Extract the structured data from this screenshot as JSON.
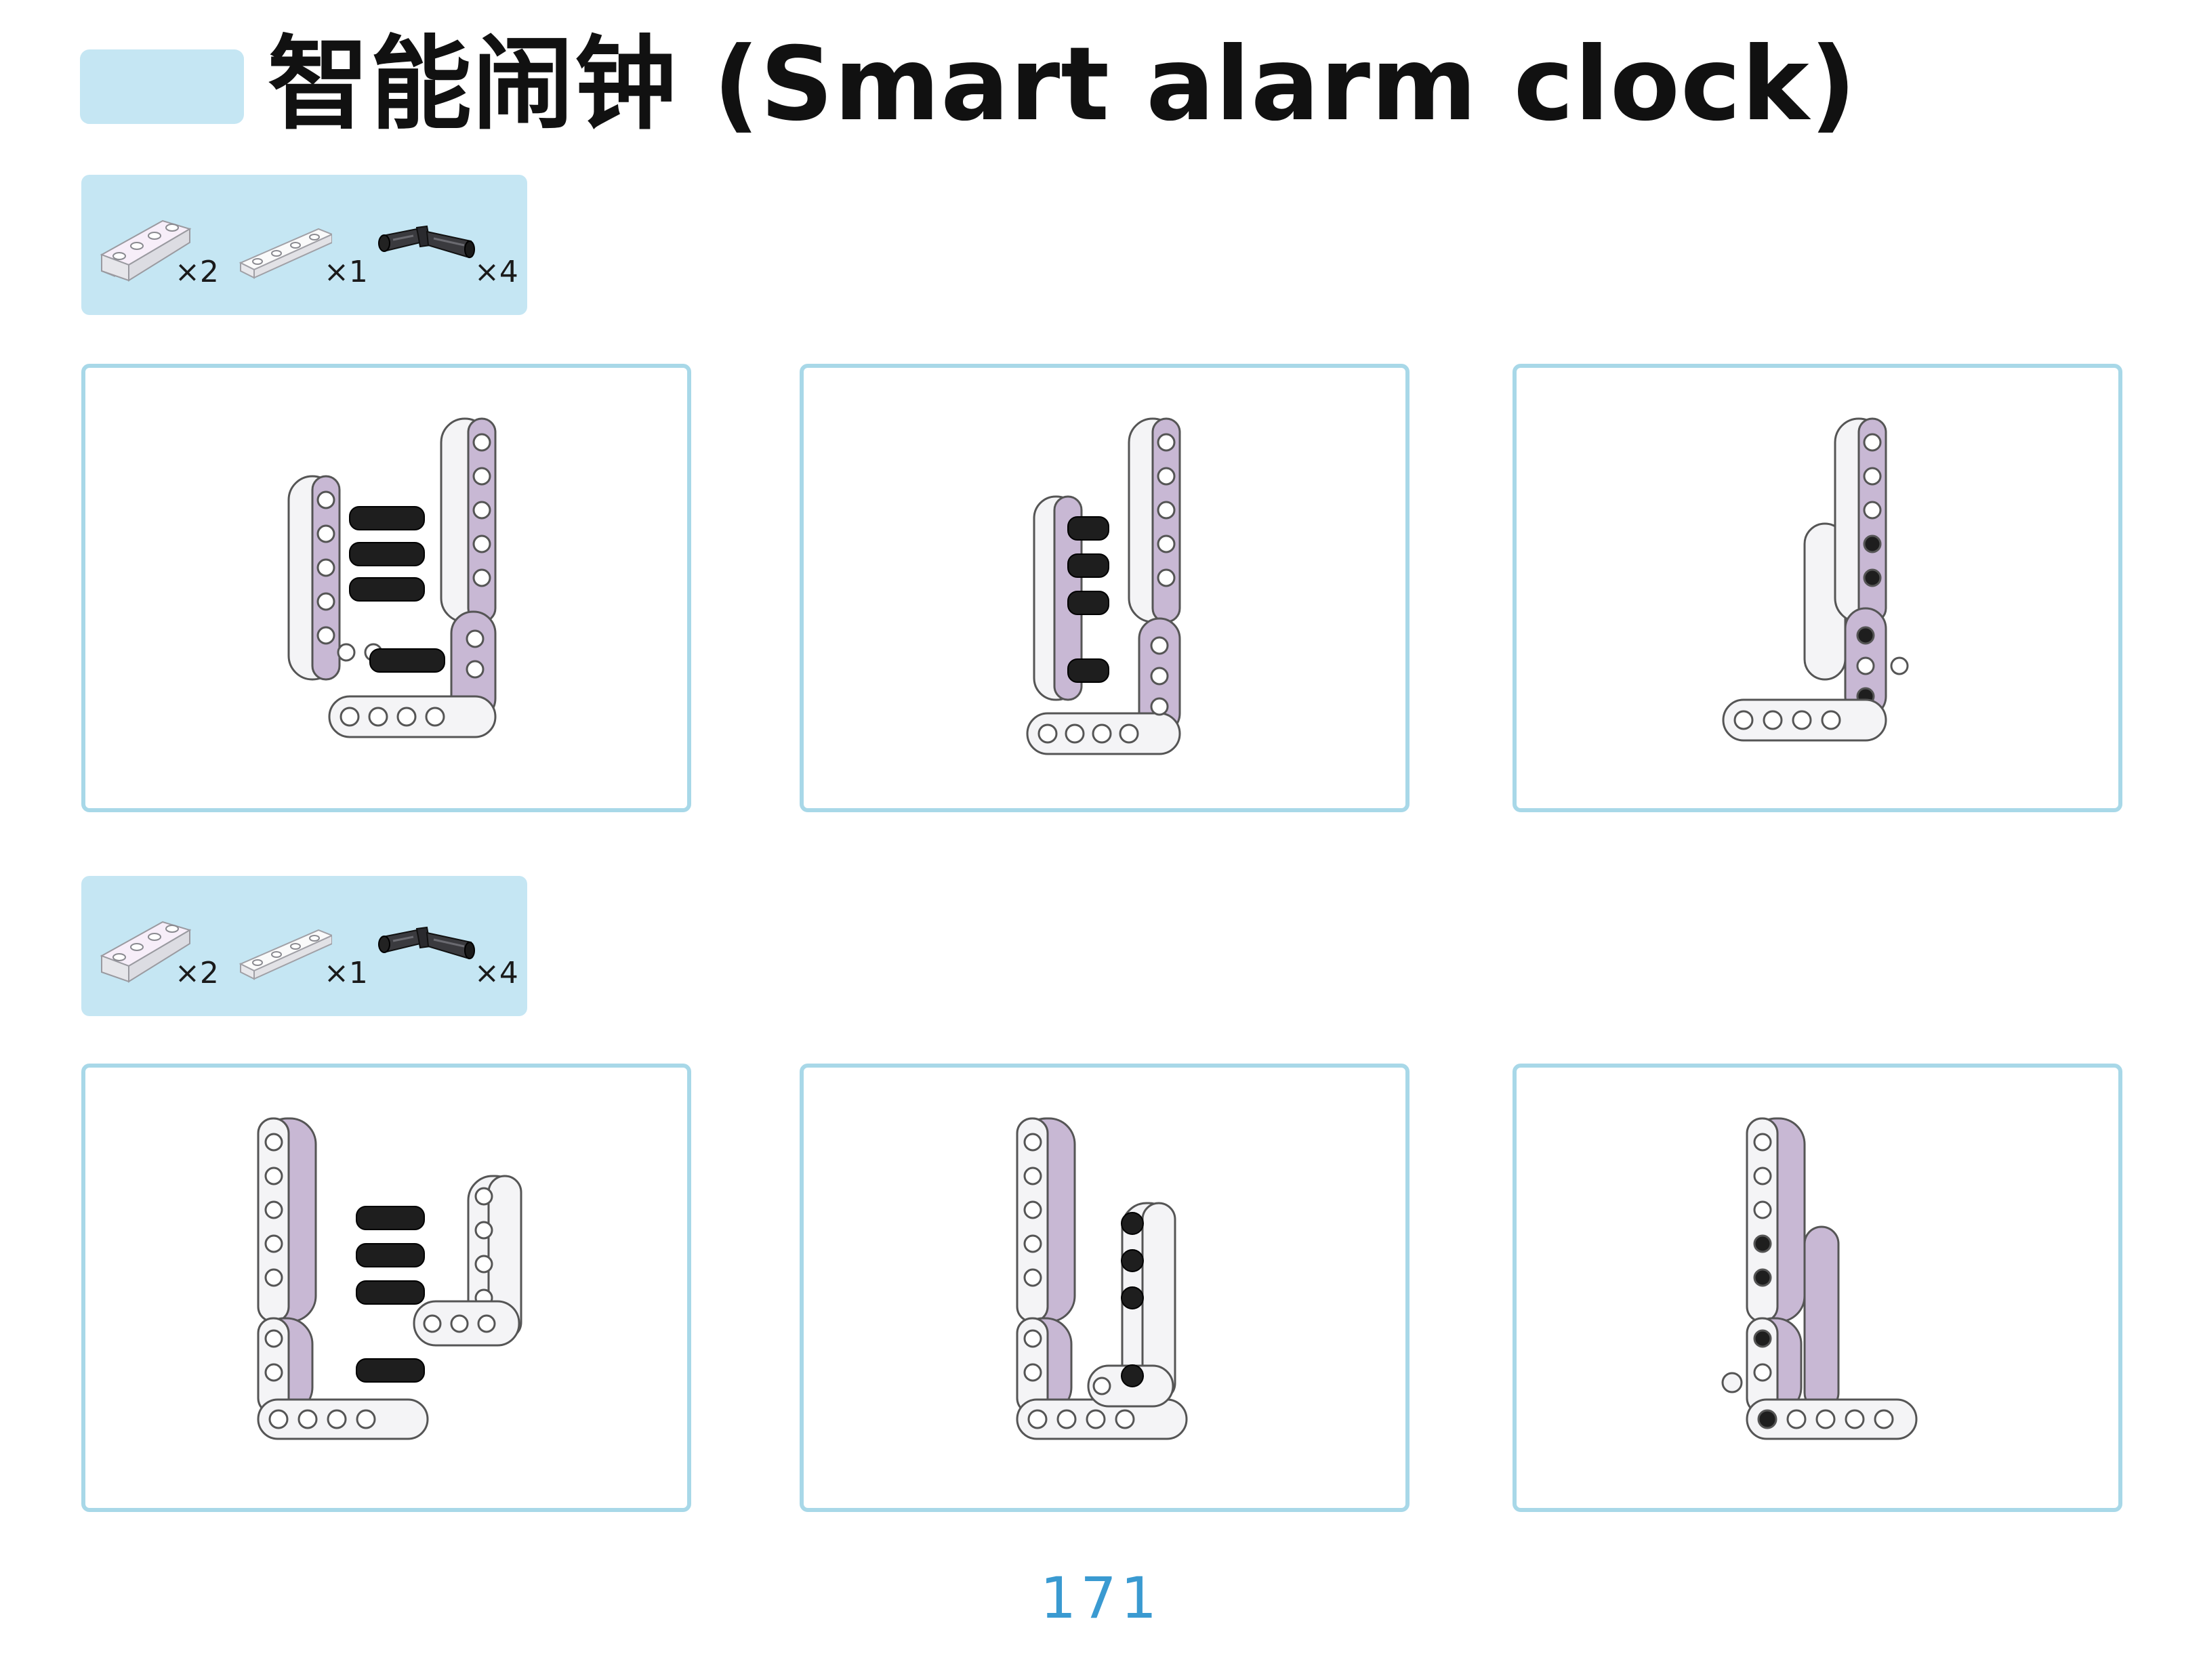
{
  "page": {
    "title": "智能闹钟 (Smart alarm clock)",
    "page_number": "171"
  },
  "colors": {
    "accent_block": "#c5e6f3",
    "panel_border": "#a8d8e8",
    "beam_lilac": "#c8b8d4",
    "beam_white": "#f4f4f6",
    "pin_black": "#1e1e1e",
    "page_number": "#3a9ad1"
  },
  "steps": [
    {
      "parts": [
        {
          "icon": "lilac-l-beam-icon",
          "qty": "×2"
        },
        {
          "icon": "white-straight-beam-icon",
          "qty": "×1"
        },
        {
          "icon": "black-pin-icon",
          "qty": "×4"
        }
      ],
      "panels": [
        {
          "icon": "assembly-step-1-icon"
        },
        {
          "icon": "assembly-step-2-icon"
        },
        {
          "icon": "assembly-step-3-icon"
        }
      ]
    },
    {
      "parts": [
        {
          "icon": "lilac-l-beam-icon",
          "qty": "×2"
        },
        {
          "icon": "white-straight-beam-icon",
          "qty": "×1"
        },
        {
          "icon": "black-pin-icon",
          "qty": "×4"
        }
      ],
      "panels": [
        {
          "icon": "assembly-step-4-icon"
        },
        {
          "icon": "assembly-step-5-icon"
        },
        {
          "icon": "assembly-step-6-icon"
        }
      ]
    }
  ]
}
